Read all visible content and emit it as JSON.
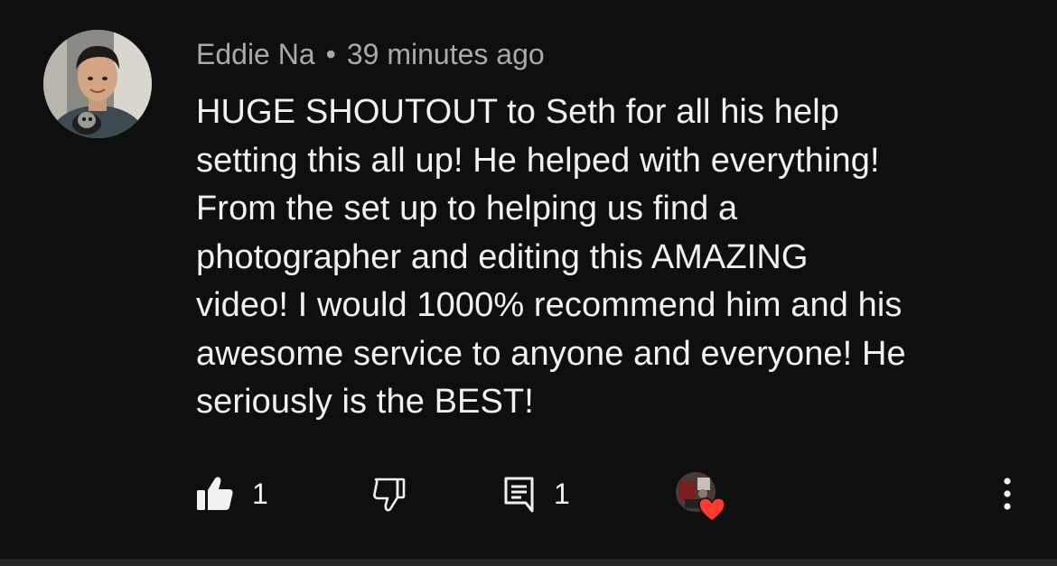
{
  "comment": {
    "author": "Eddie Na",
    "separator": "•",
    "timestamp": "39 minutes ago",
    "text_lines": [
      "HUGE SHOUTOUT to Seth for all his help",
      "setting this all up! He helped with everything!",
      "From the set up to helping us find a",
      "photographer and editing this AMAZING",
      "video! I would 1000% recommend him and his",
      "awesome service to anyone and everyone! He",
      "seriously is the BEST!"
    ]
  },
  "actions": {
    "like_icon": "thumbs-up-filled-icon",
    "like_count": "1",
    "dislike_icon": "thumbs-down-outline-icon",
    "reply_icon": "reply-comment-icon",
    "reply_count": "1",
    "creator_heart_icon": "heart-icon",
    "more_icon": "more-vertical-icon"
  },
  "colors": {
    "background": "#0f0f0f",
    "text_primary": "#f1f1f1",
    "text_secondary": "#aaaaaa",
    "heart": "#ff3b30"
  }
}
